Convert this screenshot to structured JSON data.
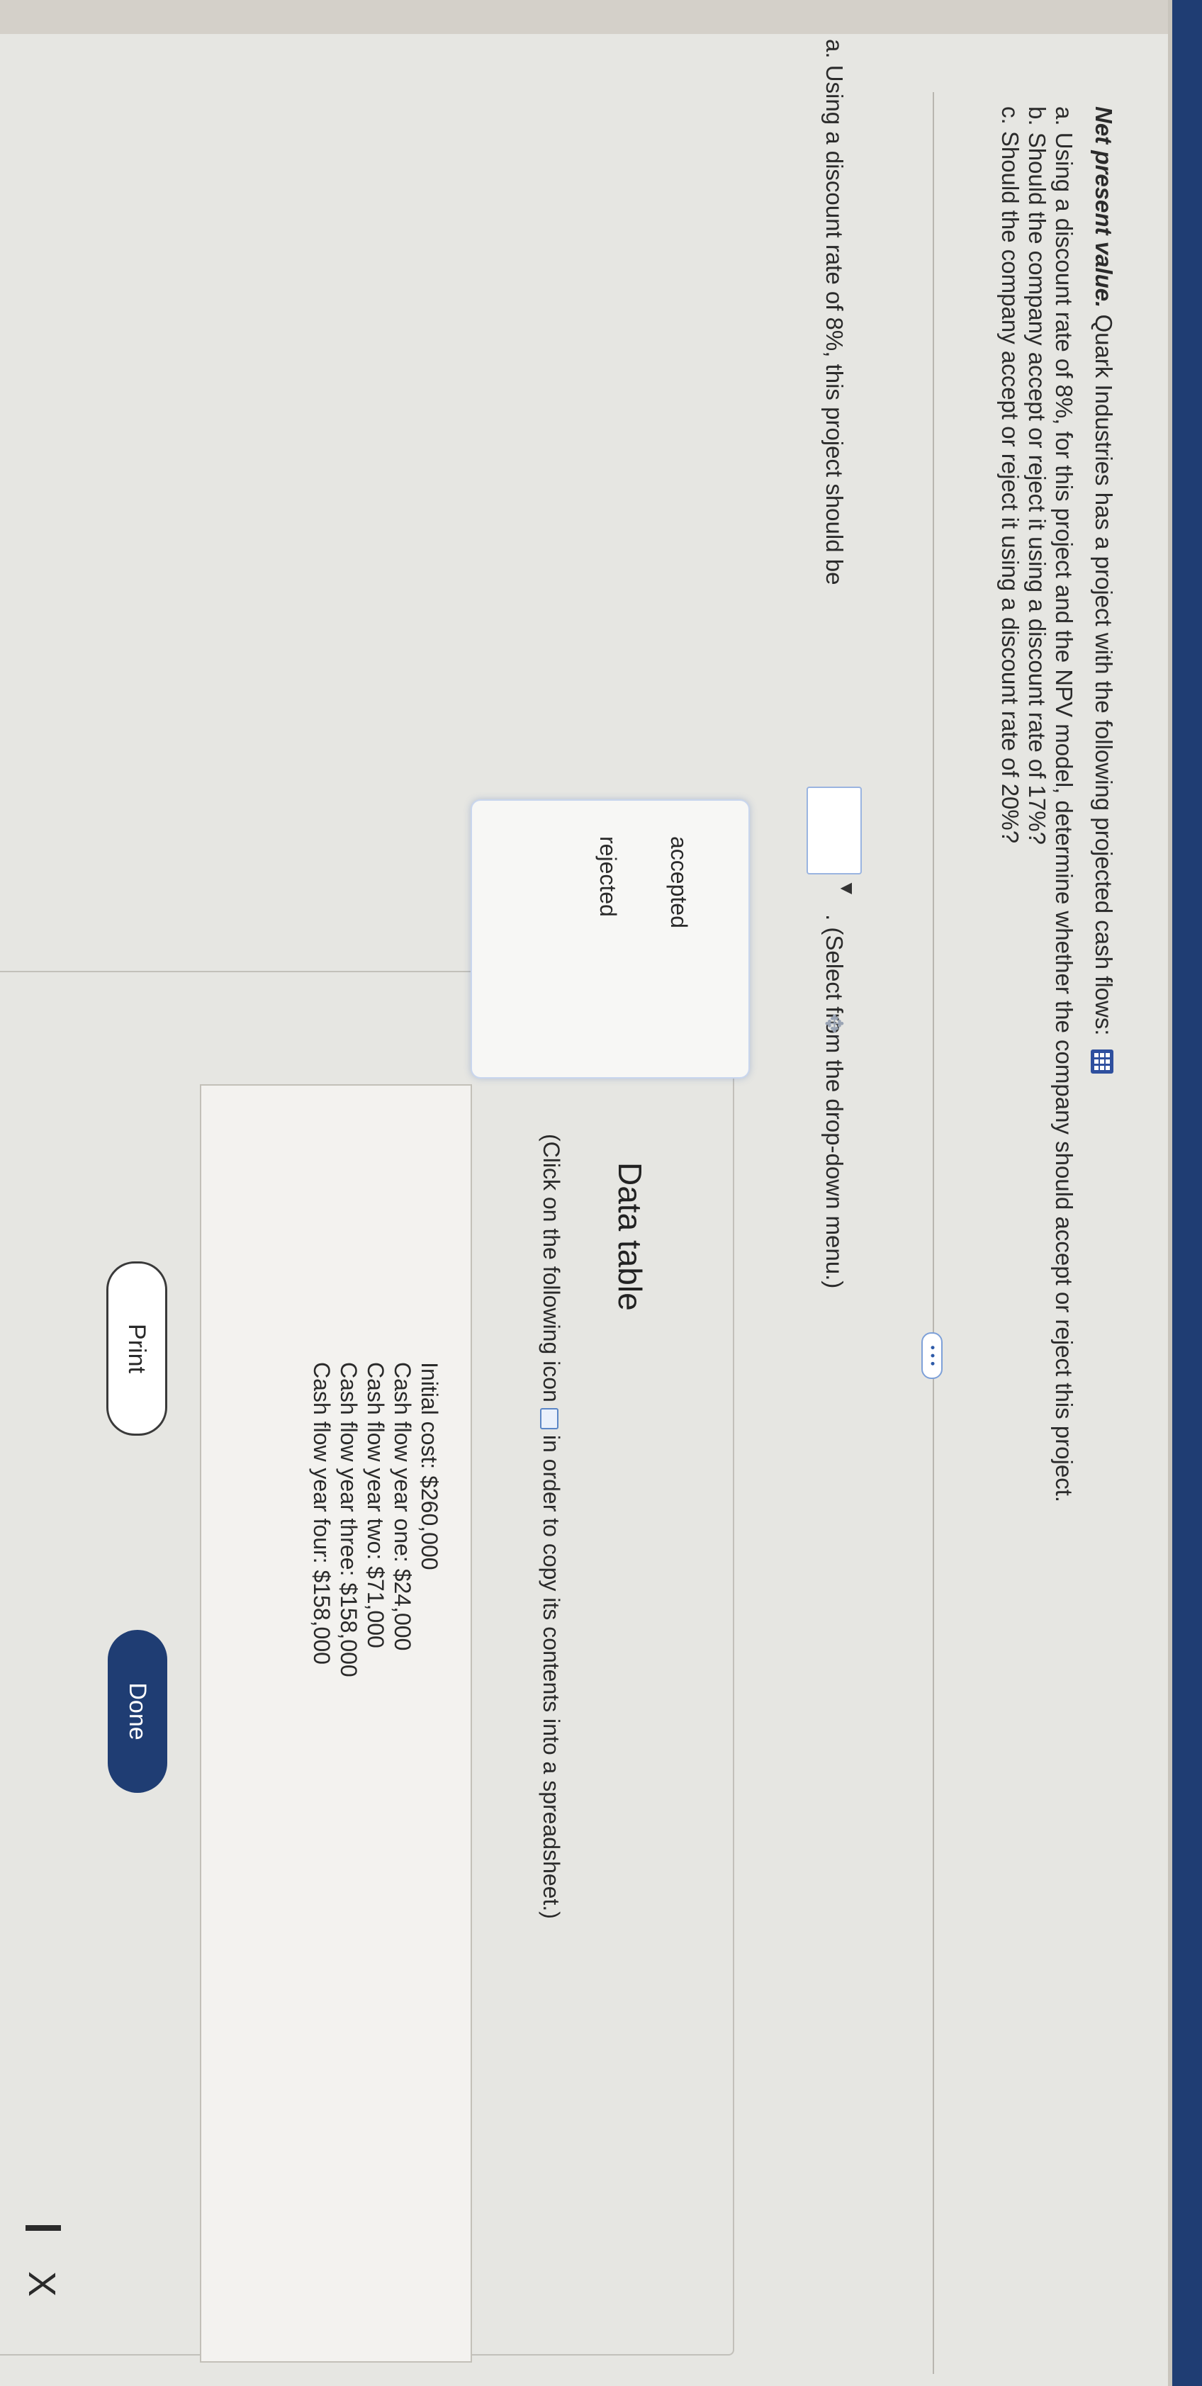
{
  "question": {
    "title_bold": "Net present value.",
    "intro": "Quark Industries has a project with the following projected cash flows:",
    "line_a": "a. Using a discount rate of 8%, for this project and the NPV model, determine whether the company should accept or reject this project.",
    "line_b": "b. Should the company accept or reject it using a discount rate of 17%?",
    "line_c": "c. Should the company accept or reject it using a discount rate of 20%?",
    "ellipsis": "• • •"
  },
  "part_a": {
    "prompt": "a. Using a discount rate of 8%, this project should be",
    "selected_value": "",
    "hint": ". (Select from the drop-down menu.)",
    "options": [
      "accepted",
      "rejected"
    ]
  },
  "data_table": {
    "title": "Data table",
    "note_before": "(Click on the following icon",
    "note_after": "in order to copy its contents into a spreadsheet.)",
    "rows": [
      "Initial cost: $260,000",
      "Cash flow year one: $24,000",
      "Cash flow year two: $71,000",
      "Cash flow year three: $158,000",
      "Cash flow year four: $158,000"
    ],
    "print_label": "Print",
    "done_label": "Done"
  },
  "window": {
    "close_glyph": "X"
  },
  "colors": {
    "accent": "#1f3d73",
    "link_blue": "#2e4f9e"
  }
}
